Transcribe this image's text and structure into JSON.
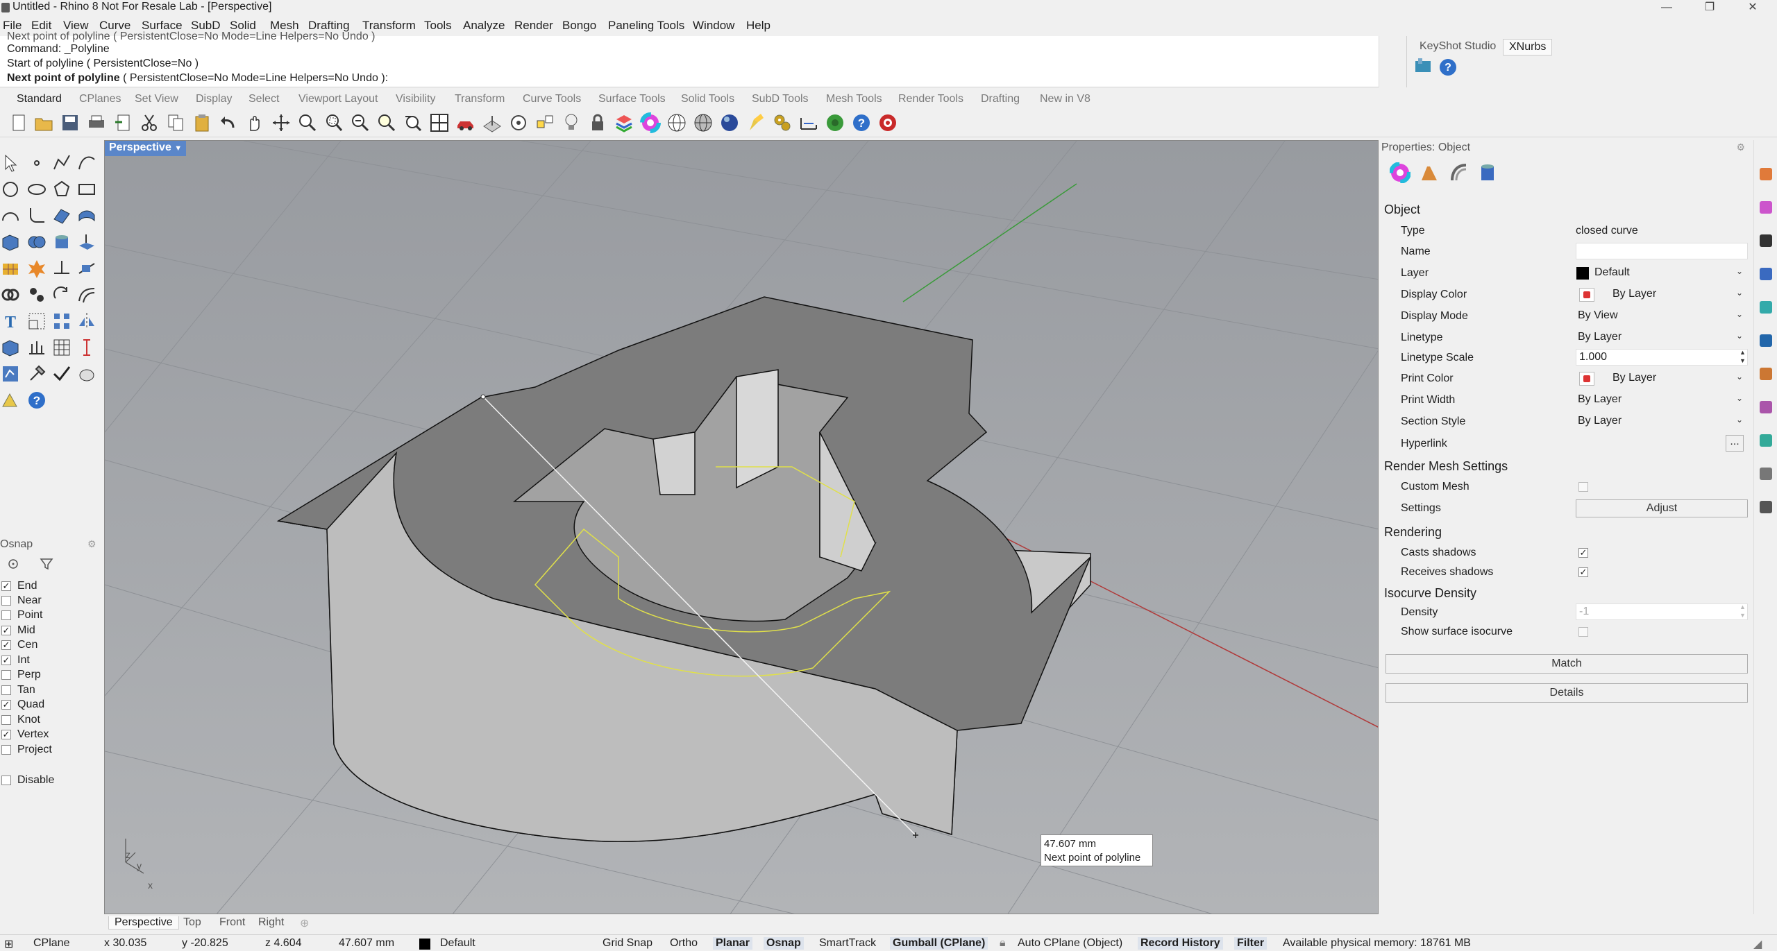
{
  "window": {
    "title": "Untitled - Rhino 8 Not For Resale Lab - [Perspective]"
  },
  "menu": [
    "File",
    "Edit",
    "View",
    "Curve",
    "Surface",
    "SubD",
    "Solid",
    "Mesh",
    "Drafting",
    "Transform",
    "Tools",
    "Analyze",
    "Render",
    "Bongo",
    "Paneling Tools",
    "Window",
    "Help"
  ],
  "command": {
    "line1": "Next point of polyline ( PersistentClose=No  Mode=Line  Helpers=No  Undo )",
    "line2": "Command: _Polyline",
    "line3": "Start of polyline ( PersistentClose=No )",
    "prompt_bold": "Next point of polyline",
    "prompt_rest": " ( PersistentClose=No  Mode=Line  Helpers=No  Undo ):"
  },
  "keyshot_tabs": [
    "KeyShot Studio",
    "XNurbs"
  ],
  "toolbar_tabs": [
    "Standard",
    "CPlanes",
    "Set View",
    "Display",
    "Select",
    "Viewport Layout",
    "Visibility",
    "Transform",
    "Curve Tools",
    "Surface Tools",
    "Solid Tools",
    "SubD Tools",
    "Mesh Tools",
    "Render Tools",
    "Drafting",
    "New in V8"
  ],
  "osnap": {
    "title": "Osnap",
    "items": [
      {
        "label": "End",
        "checked": true
      },
      {
        "label": "Near",
        "checked": false
      },
      {
        "label": "Point",
        "checked": false
      },
      {
        "label": "Mid",
        "checked": true
      },
      {
        "label": "Cen",
        "checked": true
      },
      {
        "label": "Int",
        "checked": true
      },
      {
        "label": "Perp",
        "checked": false
      },
      {
        "label": "Tan",
        "checked": false
      },
      {
        "label": "Quad",
        "checked": true
      },
      {
        "label": "Knot",
        "checked": false
      },
      {
        "label": "Vertex",
        "checked": true
      },
      {
        "label": "Project",
        "checked": false
      }
    ],
    "disable": "Disable"
  },
  "viewport": {
    "label": "Perspective",
    "tooltip_distance": "47.607 mm",
    "tooltip_prompt": "Next point of polyline",
    "axis_z": "z",
    "axis_y": "y",
    "axis_x": "x"
  },
  "view_tabs": [
    "Perspective",
    "Top",
    "Front",
    "Right"
  ],
  "properties": {
    "header": "Properties: Object",
    "section_object": "Object",
    "rows": {
      "type_label": "Type",
      "type_value": "closed curve",
      "name_label": "Name",
      "name_value": "",
      "layer_label": "Layer",
      "layer_value": "Default",
      "display_color_label": "Display Color",
      "display_color_value": "By Layer",
      "display_mode_label": "Display Mode",
      "display_mode_value": "By View",
      "linetype_label": "Linetype",
      "linetype_value": "By Layer",
      "linetype_scale_label": "Linetype Scale",
      "linetype_scale_value": "1.000",
      "print_color_label": "Print Color",
      "print_color_value": "By Layer",
      "print_width_label": "Print Width",
      "print_width_value": "By Layer",
      "section_style_label": "Section Style",
      "section_style_value": "By Layer",
      "hyperlink_label": "Hyperlink",
      "hyperlink_btn": "..."
    },
    "section_rms": "Render Mesh Settings",
    "custom_mesh_label": "Custom Mesh",
    "settings_label": "Settings",
    "adjust_btn": "Adjust",
    "section_rendering": "Rendering",
    "casts_label": "Casts shadows",
    "receives_label": "Receives shadows",
    "section_isocurve": "Isocurve Density",
    "density_label": "Density",
    "density_value": "-1",
    "show_iso_label": "Show surface isocurve",
    "match_btn": "Match",
    "details_btn": "Details"
  },
  "status": {
    "cplane": "CPlane",
    "x": "x 30.035",
    "y": "y -20.825",
    "z": "z 4.604",
    "dist": "47.607 mm",
    "layer": "Default",
    "grid_snap": "Grid Snap",
    "ortho": "Ortho",
    "planar": "Planar",
    "osnap": "Osnap",
    "smarttrack": "SmartTrack",
    "gumball": "Gumball (CPlane)",
    "auto_cplane": "Auto CPlane (Object)",
    "record_history": "Record History",
    "filter": "Filter",
    "memory": "Available physical memory: 18761 MB"
  },
  "colors": {
    "viewport_bg": "#a4a7ab",
    "accent": "#5a86c9",
    "curve": "#e0e04a",
    "x_axis": "#b03a3a",
    "y_axis": "#3a9a3a"
  }
}
